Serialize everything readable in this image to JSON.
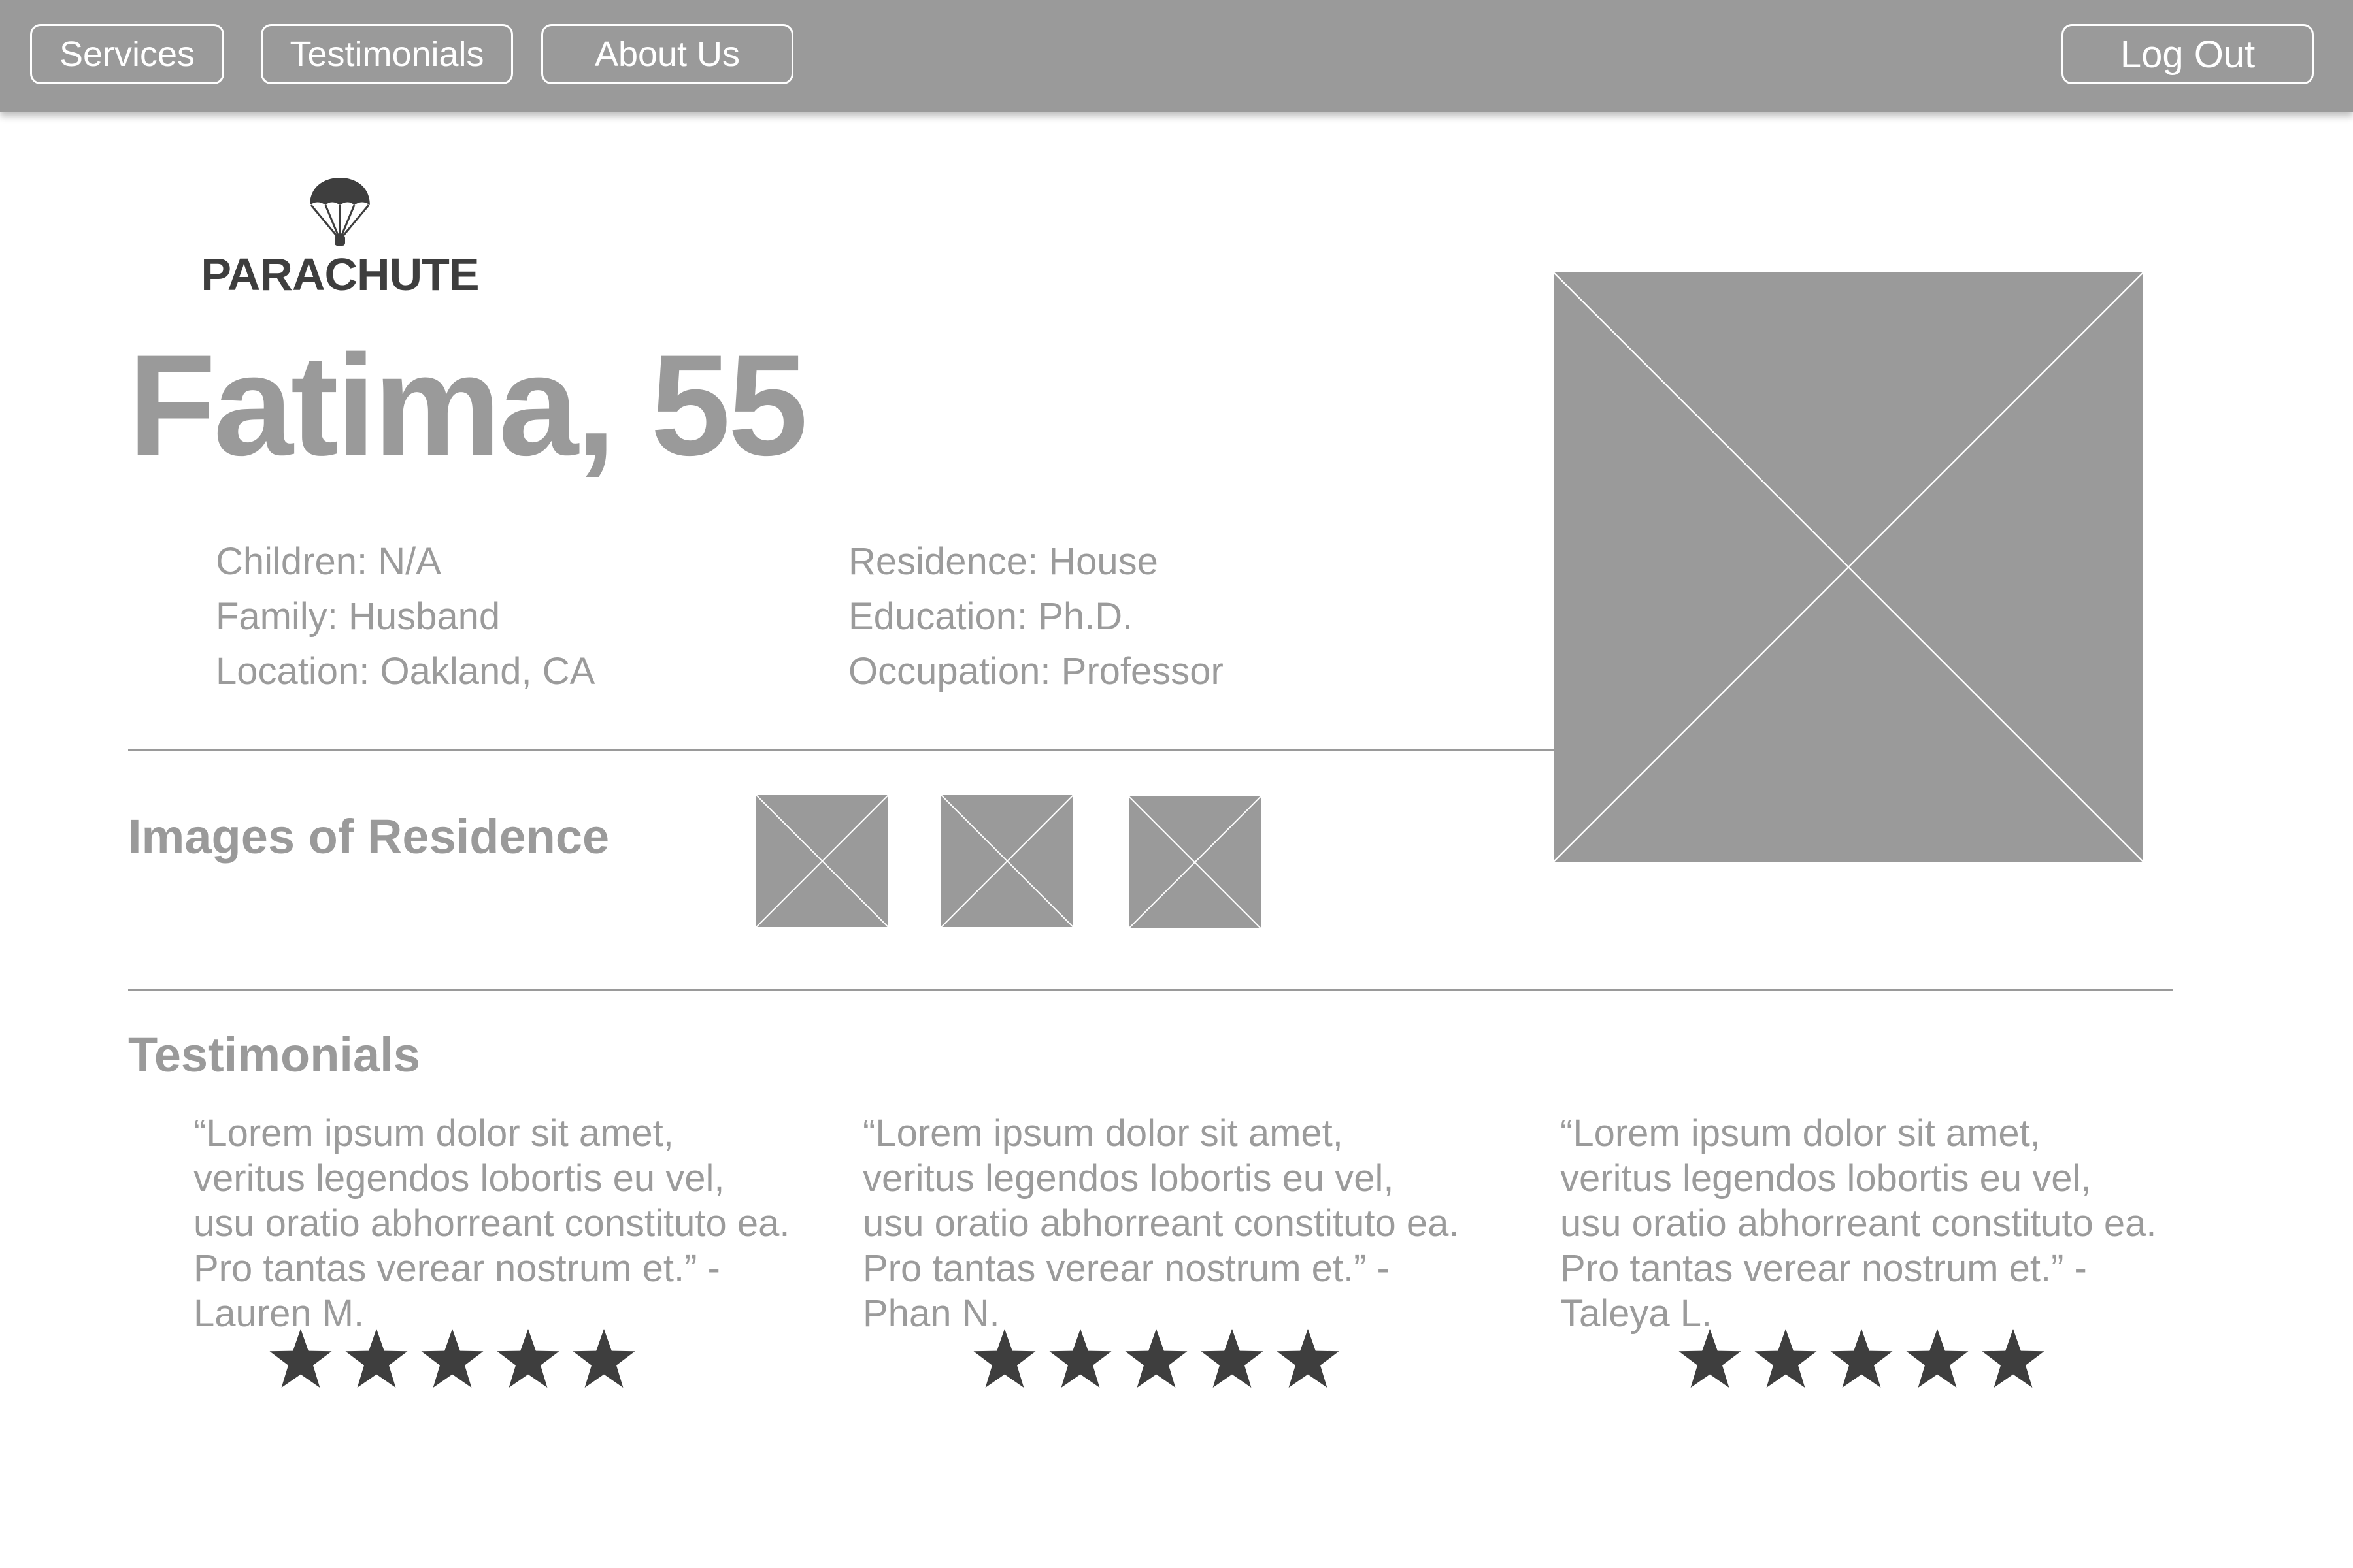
{
  "nav": {
    "services": "Services",
    "testimonials": "Testimonials",
    "about": "About Us",
    "logout": "Log Out"
  },
  "logo": {
    "text": "PARACHUTE",
    "icon": "parachute-icon"
  },
  "profile": {
    "name_age": "Fatima, 55",
    "details_left": [
      "Children: N/A",
      "Family: Husband",
      "Location: Oakland, CA"
    ],
    "details_right": [
      "Residence: House",
      "Education: Ph.D.",
      "Occupation: Professor"
    ]
  },
  "residence": {
    "title": "Images of Residence"
  },
  "testimonials": {
    "title": "Testimonials",
    "items": [
      {
        "quote": "“Lorem ipsum dolor sit amet, veritus legendos lobortis eu vel, usu oratio abhorreant constituto ea. Pro tantas verear nostrum et.”  -Lauren M.",
        "rating": 5
      },
      {
        "quote": "“Lorem ipsum dolor sit amet, veritus legendos lobortis eu vel, usu oratio abhorreant constituto ea. Pro tantas verear nostrum et.”  -Phan N.",
        "rating": 5
      },
      {
        "quote": "“Lorem ipsum dolor sit amet, veritus legendos lobortis eu vel, usu oratio abhorreant constituto ea. Pro tantas verear nostrum et.”  -Taleya L.",
        "rating": 5
      }
    ]
  },
  "colors": {
    "nav_bar": "#9a9a9a",
    "placeholder": "#9a9a9a",
    "text": "#9b9b9b",
    "star": "#3e3e3e",
    "logo": "#3e3e3e"
  }
}
